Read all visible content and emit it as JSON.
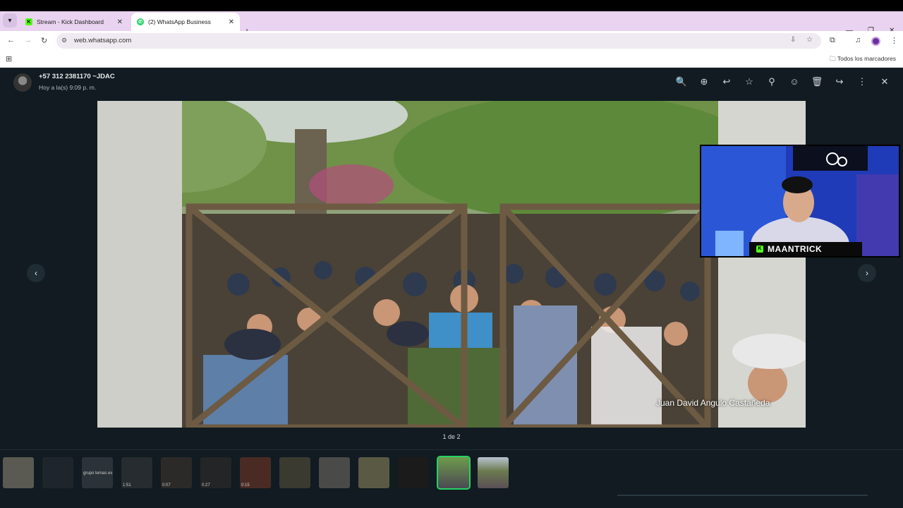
{
  "browser": {
    "tabs": [
      {
        "title": "Stream - Kick Dashboard",
        "favicon": "kick-icon"
      },
      {
        "title": "(2) WhatsApp Business",
        "favicon": "whatsapp-icon"
      }
    ],
    "url": "web.whatsapp.com",
    "bookmarks_label": "Todos los marcadores"
  },
  "viewer": {
    "sender": "+57 312 2381170 ~JDAC",
    "timestamp": "Hoy a la(s) 9:09 p. m.",
    "counter": "1 de 2",
    "watermark": "Juan David Angulo Castañeda",
    "webcam_name": "MAANTRICK"
  },
  "thumbnails": [
    {
      "label": ""
    },
    {
      "label": ""
    },
    {
      "label": "grupo temas ex"
    },
    {
      "label": "1:51"
    },
    {
      "label": "0:07"
    },
    {
      "label": "0:27"
    },
    {
      "label": "0:15"
    },
    {
      "label": ""
    },
    {
      "label": ""
    },
    {
      "label": ""
    },
    {
      "label": ""
    },
    {
      "label": ""
    },
    {
      "label": ""
    }
  ],
  "colors": {
    "accent": "#25d366",
    "viewer_bg": "#111b21",
    "tabstrip": "#e9d3f0",
    "kick": "#53fc18"
  }
}
